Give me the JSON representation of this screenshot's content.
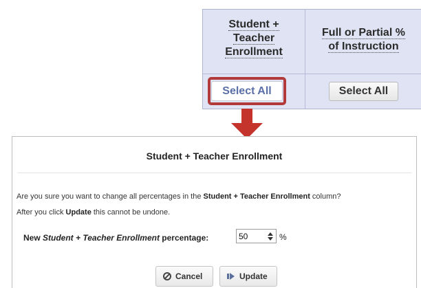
{
  "table": {
    "col1_header": [
      "Student +",
      "Teacher",
      "Enrollment"
    ],
    "col2_header": [
      "Full or Partial %",
      "of Instruction"
    ],
    "col1_button": "Select All",
    "col2_button": "Select All"
  },
  "dialog": {
    "title": "Student + Teacher Enrollment",
    "msg1_pre": "Are you sure you want to change all percentages in the ",
    "msg1_bold": "Student + Teacher Enrollment",
    "msg1_post": " column?",
    "msg2_pre": "After you click ",
    "msg2_bold": "Update",
    "msg2_post": " this cannot be undone.",
    "field_label_pre": "New ",
    "field_label_italic": "Student + Teacher Enrollment",
    "field_label_post": " percentage:",
    "field_value": "50",
    "unit": "%",
    "cancel_label": "Cancel",
    "update_label": "Update"
  },
  "colors": {
    "highlight": "#b23a3a",
    "arrow": "#c4342d",
    "table_bg": "#dfe3f3"
  },
  "icons": {
    "cancel": "cancel-icon",
    "update": "update-icon",
    "arrow": "down-arrow-icon"
  }
}
